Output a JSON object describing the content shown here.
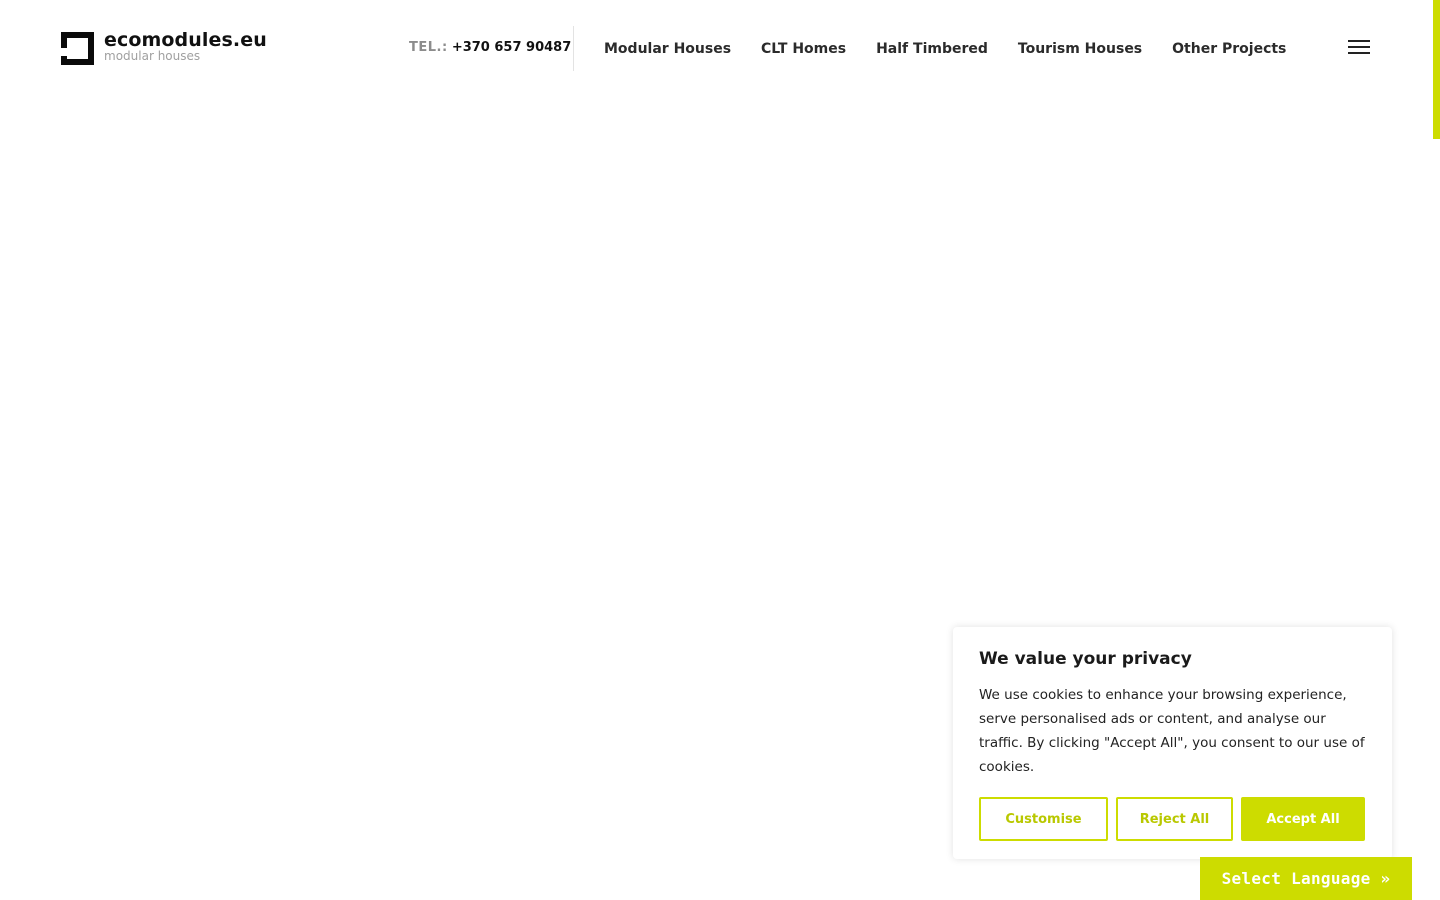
{
  "brand": {
    "title": "ecomodules.eu",
    "subtitle": "modular houses",
    "logo_icon": "square-frame-logo-icon"
  },
  "header": {
    "phone_label": "TEL.:",
    "phone_number": "+370 657 90487",
    "menu_icon": "hamburger-menu-icon"
  },
  "nav": {
    "items": [
      {
        "label": "Modular Houses"
      },
      {
        "label": "CLT Homes"
      },
      {
        "label": "Half Timbered"
      },
      {
        "label": "Tourism Houses"
      },
      {
        "label": "Other Projects"
      }
    ]
  },
  "cookie": {
    "title": "We value your privacy",
    "text": "We use cookies to enhance your browsing experience, serve personalised ads or content, and analyse our traffic. By clicking \"Accept All\", you consent to our use of cookies.",
    "customise_label": "Customise",
    "reject_label": "Reject All",
    "accept_label": "Accept All"
  },
  "language": {
    "label": "Select Language »"
  },
  "colors": {
    "accent": "#cddc00",
    "text": "#222222",
    "muted": "#8c8c8c"
  }
}
